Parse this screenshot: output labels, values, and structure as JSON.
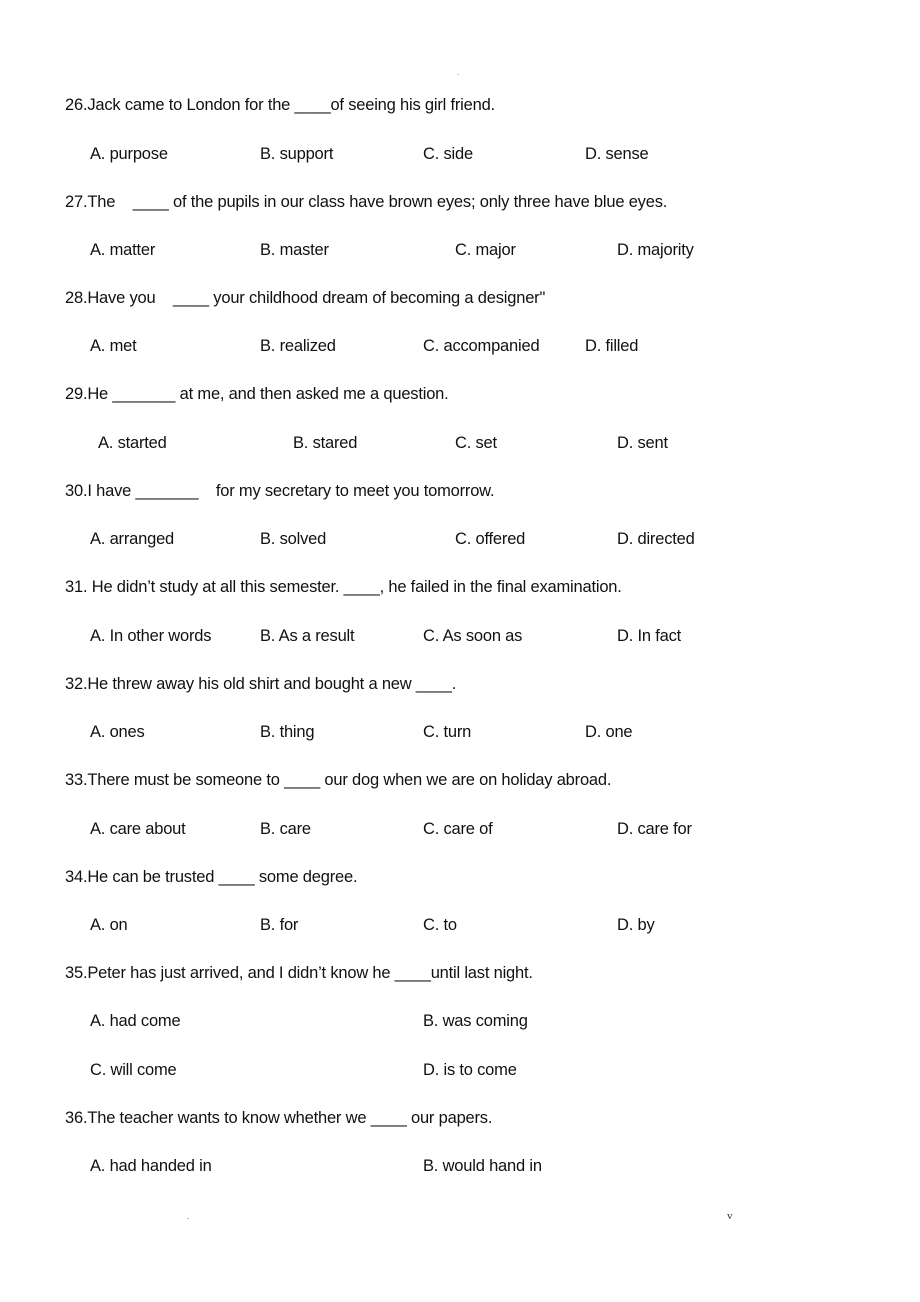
{
  "header": {
    "mark": "."
  },
  "questions": [
    {
      "number": "26.",
      "before": "Jack came to London for the ",
      "blank": "____",
      "after": "of seeing his girl friend.",
      "options": [
        "A. purpose",
        "B. support",
        "C. side",
        "D. sense"
      ]
    },
    {
      "number": "27.",
      "before": "The    ",
      "blank": "____",
      "after": " of the pupils in our class have brown eyes; only three have blue eyes.",
      "options": [
        "A. matter",
        "B. master",
        "C. major",
        "D. majority"
      ]
    },
    {
      "number": "28.",
      "before": "Have you    ",
      "blank": "____",
      "after": " your childhood dream of becoming a designer\"",
      "options": [
        "A. met",
        "B. realized",
        "C. accompanied",
        "D. filled"
      ]
    },
    {
      "number": "29.",
      "before": "He ",
      "blank": "_______",
      "after": " at me, and then asked me a question.",
      "options": [
        "A. started",
        "B. stared",
        "C. set",
        "D. sent"
      ]
    },
    {
      "number": "30.",
      "before": "I have ",
      "blank": "_______",
      "after": "    for my secretary to meet you tomorrow.",
      "options": [
        "A. arranged",
        "B. solved",
        "C. offered",
        "D. directed"
      ]
    },
    {
      "number": "31.",
      "before": " He didn’t study at all this semester. ",
      "blank": "____",
      "after": ", he failed in the final examination.",
      "options": [
        "A. In other words",
        "B. As a result",
        "C. As soon as",
        "D. In fact"
      ]
    },
    {
      "number": "32.",
      "before": "He threw away his old shirt and bought a new ",
      "blank": "____",
      "after": ".",
      "options": [
        "A. ones",
        "B. thing",
        "C. turn",
        "D. one"
      ]
    },
    {
      "number": "33.",
      "before": "There must be someone to ",
      "blank": "____",
      "after": " our dog when we are on holiday abroad.",
      "options": [
        "A. care about",
        "B. care",
        "C. care of",
        "D. care for"
      ]
    },
    {
      "number": "34.",
      "before": "He can be trusted ",
      "blank": "____",
      "after": " some degree.",
      "options": [
        "A. on",
        "B. for",
        "C. to",
        "D. by"
      ]
    },
    {
      "number": "35.",
      "before": "Peter has just arrived, and I didn’t know he ",
      "blank": "____",
      "after": "until last night.",
      "options": [
        "A. had come",
        "B. was coming",
        "C. will come",
        "D. is to come"
      ]
    },
    {
      "number": "36.",
      "before": "The teacher wants to know whether we ",
      "blank": "____",
      "after": " our papers.",
      "options": [
        "A. had handed in",
        "B. would hand in"
      ]
    }
  ],
  "footer": {
    "left_mark": ".",
    "right_mark": "v"
  }
}
